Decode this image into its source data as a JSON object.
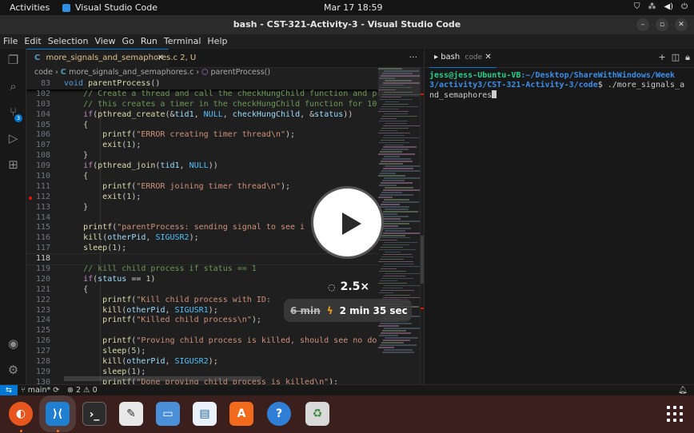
{
  "topbar": {
    "activities": "Activities",
    "app_name": "Visual Studio Code",
    "clock": "Mar 17  18:59"
  },
  "window": {
    "title": "bash - CST-321-Activity-3 - Visual Studio Code"
  },
  "menu": [
    "File",
    "Edit",
    "Selection",
    "View",
    "Go",
    "Run",
    "Terminal",
    "Help"
  ],
  "activity_bar": {
    "items": [
      "explorer-icon",
      "search-icon",
      "source-control-icon",
      "run-debug-icon",
      "extensions-icon"
    ],
    "scm_badge": "3",
    "bottom": [
      "account-icon",
      "settings-gear-icon"
    ]
  },
  "editor": {
    "tab_label": "more_signals_and_semaphores.c",
    "tab_status": "2, U",
    "breadcrumb": [
      "code",
      "more_signals_and_semaphores.c",
      "parentProcess()"
    ],
    "lines": [
      {
        "n": "83",
        "t": "void parentProcess()",
        "sticky": true
      },
      {
        "n": "102",
        "t": "    // Create a thread and call the checkHungChild function and p"
      },
      {
        "n": "103",
        "t": "    // this creates a timer in the checkHungChild function for 10"
      },
      {
        "n": "104",
        "t": "    if(pthread_create(&tid1, NULL, checkHungChild, &status))"
      },
      {
        "n": "105",
        "t": "    {"
      },
      {
        "n": "106",
        "t": "        printf(\"ERROR creating timer thread\\n\");"
      },
      {
        "n": "107",
        "t": "        exit(1);"
      },
      {
        "n": "108",
        "t": "    }"
      },
      {
        "n": "109",
        "t": "    if(pthread_join(tid1, NULL))"
      },
      {
        "n": "110",
        "t": "    {"
      },
      {
        "n": "111",
        "t": "        printf(\"ERROR joining timer thread\\n\");"
      },
      {
        "n": "112",
        "t": "        exit(1);",
        "breakpoint": true
      },
      {
        "n": "113",
        "t": "    }"
      },
      {
        "n": "114",
        "t": ""
      },
      {
        "n": "115",
        "t": "    printf(\"parentProcess: sending signal to see i"
      },
      {
        "n": "116",
        "t": "    kill(otherPid, SIGUSR2);"
      },
      {
        "n": "117",
        "t": "    sleep(1);"
      },
      {
        "n": "118",
        "t": "",
        "current": true
      },
      {
        "n": "119",
        "t": "    // kill child process if status == 1"
      },
      {
        "n": "120",
        "t": "    if(status == 1)"
      },
      {
        "n": "121",
        "t": "    {"
      },
      {
        "n": "122",
        "t": "        printf(\"Kill child process with ID:"
      },
      {
        "n": "123",
        "t": "        kill(otherPid, SIGUSR1);"
      },
      {
        "n": "124",
        "t": "        printf(\"Killed child process\\n\");"
      },
      {
        "n": "125",
        "t": ""
      },
      {
        "n": "126",
        "t": "        printf(\"Proving child process is killed, should see no do"
      },
      {
        "n": "127",
        "t": "        sleep(5);"
      },
      {
        "n": "128",
        "t": "        kill(otherPid, SIGUSR2);"
      },
      {
        "n": "129",
        "t": "        sleep(1);"
      },
      {
        "n": "130",
        "t": "        printf(\"Done proving child process is killed\\n\");"
      }
    ]
  },
  "terminal": {
    "tab_label": "bash",
    "tab_sub": "code",
    "prompt_user": "jess@jess-Ubuntu-VB",
    "prompt_path": ":~/Desktop/ShareWithWindows/Week 3/activity3/CST-321-Activity-3/code",
    "prompt_end": "$ ",
    "command": "./more_signals_and_semaphores"
  },
  "statusbar": {
    "branch": "main*",
    "problems": "⊗ 2 ⚠ 0"
  },
  "overlay": {
    "speed": "2.5×",
    "old_time": "6 min",
    "new_time": "2 min 35 sec"
  },
  "dock": [
    "firefox-icon",
    "vscode-icon",
    "terminal-icon",
    "text-editor-icon",
    "files-icon",
    "writer-icon",
    "software-center-icon",
    "help-icon",
    "trash-icon"
  ],
  "colors": {
    "accent": "#0078d4",
    "error": "#e51400",
    "terminal_user": "#23d18b",
    "terminal_path": "#3b8eea"
  }
}
